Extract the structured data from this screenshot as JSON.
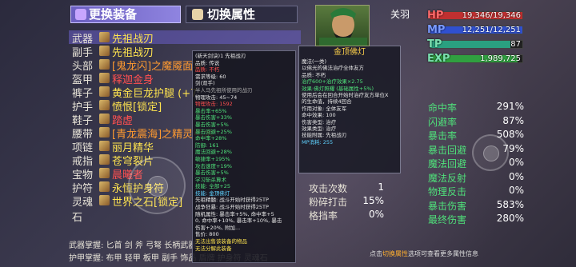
{
  "tabs": {
    "equip": "更换装备",
    "attr": "切换属性"
  },
  "hero": {
    "name": "关羽"
  },
  "bars": [
    {
      "label": "HP",
      "value": "19,346/19,346",
      "color": "#c03030",
      "fill": 1.0
    },
    {
      "label": "MP",
      "value": "12,251/12,251",
      "color": "#3050d0",
      "fill": 1.0
    },
    {
      "label": "TP",
      "value": "87",
      "color": "#2aa080",
      "fill": 0.87
    },
    {
      "label": "EXP",
      "value": "1,989,725",
      "color": "#30a040",
      "fill": 0.95
    }
  ],
  "equipment": [
    {
      "slot": "武器",
      "name": "先祖战刃",
      "color": "#ffe44f"
    },
    {
      "slot": "副手",
      "name": "先祖战刃",
      "color": "#ffe44f"
    },
    {
      "slot": "头部",
      "name": "[鬼龙闪]之魔魇面容",
      "color": "#ff9a30"
    },
    {
      "slot": "盔甲",
      "name": "释迦金身",
      "color": "#ff5050"
    },
    {
      "slot": "裤子",
      "name": "黄金巨龙护腿 (+7",
      "color": "#ffe44f"
    },
    {
      "slot": "护手",
      "name": "愤恨[锁定]",
      "color": "#ffe44f"
    },
    {
      "slot": "鞋子",
      "name": "踏虚",
      "color": "#ff5050"
    },
    {
      "slot": "腰带",
      "name": "[青龙震海]之精灵弓术",
      "color": "#ff9a30"
    },
    {
      "slot": "项链",
      "name": "丽月精华",
      "color": "#ffe44f"
    },
    {
      "slot": "戒指",
      "name": "苍穹裂片",
      "color": "#ffe44f"
    },
    {
      "slot": "宝物",
      "name": "晨曦者",
      "color": "#ff5050"
    },
    {
      "slot": "护符",
      "name": "永恒护身符",
      "color": "#ffe44f"
    },
    {
      "slot": "灵魂石",
      "name": "世界之石[锁定]",
      "color": "#ffe44f"
    }
  ],
  "footer": {
    "weapon_skill": "武器掌握:    匕首 剑 斧 弓弩 长柄武器",
    "armor_skill": "护甲掌握:    布甲 轻甲 板甲 副手 饰品 盾牌 护身符 灵魂石"
  },
  "tooltip1": [
    {
      "t": "(新天剑诀)1   先祖战刃",
      "c": "c-white"
    },
    {
      "t": "品质: 传说",
      "c": "c-white"
    },
    {
      "t": "品质: 不朽",
      "c": "c-red"
    },
    {
      "t": "需求等级: 60",
      "c": "c-white"
    },
    {
      "t": "剑(双手)",
      "c": "c-white"
    },
    {
      "t": "半人马先祖所使用的战刃",
      "c": "c-gray"
    },
    {
      "t": "物理攻击: 45~74",
      "c": "c-white"
    },
    {
      "t": "物理攻击: 1592",
      "c": "c-red"
    },
    {
      "t": "暴击率+65%",
      "c": "c-green"
    },
    {
      "t": "暴击伤害+33%",
      "c": "c-green"
    },
    {
      "t": "暴击伤害+5%",
      "c": "c-green"
    },
    {
      "t": "暴击回避+25%",
      "c": "c-green"
    },
    {
      "t": "命中率+28%",
      "c": "c-green"
    },
    {
      "t": "防御: 161",
      "c": "c-green"
    },
    {
      "t": "魔法回避+28%",
      "c": "c-green"
    },
    {
      "t": "敏捷率+195%",
      "c": "c-green"
    },
    {
      "t": "攻击速度+19%",
      "c": "c-green"
    },
    {
      "t": "暴击伤害+5%",
      "c": "c-green"
    },
    {
      "t": "学习斩杀算术",
      "c": "c-green"
    },
    {
      "t": "技能: 全部+25",
      "c": "c-green"
    },
    {
      "t": "技能: 金顶佛灯",
      "c": "c-cyan"
    },
    {
      "t": "先祖精髓: 战斗开始时获得25TP",
      "c": "c-white"
    },
    {
      "t": "战争狂暴: 战斗开始时获得25TP",
      "c": "c-white"
    },
    {
      "t": "随机属性: 暴击率+5%, 命中率+5",
      "c": "c-white"
    },
    {
      "t": "0, 命中率+10%, 暴击率+10%, 暴击",
      "c": "c-white"
    },
    {
      "t": "伤害+20%, 附加...",
      "c": "c-white"
    },
    {
      "t": "售价: 800",
      "c": "c-white"
    },
    {
      "t": "无法出售该装备的物品",
      "c": "c-yellow"
    },
    {
      "t": "无法分解此装备",
      "c": "c-yellow"
    }
  ],
  "tooltip2": {
    "title": "金顶佛灯",
    "lines": [
      {
        "t": "魔法(一类)",
        "c": "c-white"
      },
      {
        "t": "以佛光的佛法治疗全体友方",
        "c": "c-white"
      },
      {
        "t": "品质: 不朽",
        "c": "c-white"
      },
      {
        "t": "治疗600+治疗效果×2.75",
        "c": "c-green"
      },
      {
        "t": "效果:佛灯照耀 (基础属性+5%)",
        "c": "c-green"
      },
      {
        "t": "使用后会在回合开始时治疗友方单位X",
        "c": "c-white"
      },
      {
        "t": "的生命值，持续4回合",
        "c": "c-white"
      },
      {
        "t": "作用对象: 全体友军",
        "c": "c-white"
      },
      {
        "t": "命中效果: 100",
        "c": "c-white"
      },
      {
        "t": "伤害类型: 治疗",
        "c": "c-white"
      },
      {
        "t": "效果类型: 治疗",
        "c": "c-white"
      },
      {
        "t": "技能附属: 先祖战刃",
        "c": "c-white"
      },
      {
        "t": "MP消耗: 255",
        "c": "c-cyan"
      }
    ]
  },
  "mid_stats": [
    {
      "label": "攻击次数",
      "value": "1"
    },
    {
      "label": "粉碎打击",
      "value": "15%"
    },
    {
      "label": "格挡率",
      "value": "0%"
    }
  ],
  "right_stats": [
    {
      "label": "命中率",
      "value": "291%"
    },
    {
      "label": "闪避率",
      "value": "87%"
    },
    {
      "label": "暴击率",
      "value": "508%"
    },
    {
      "label": "暴击回避",
      "value": "79%"
    },
    {
      "label": "魔法回避",
      "value": "0%"
    },
    {
      "label": "魔法反射",
      "value": "0%"
    },
    {
      "label": "物理反击",
      "value": "0%"
    },
    {
      "label": "暴击伤害",
      "value": "583%"
    },
    {
      "label": "最终伤害",
      "value": "280%"
    }
  ],
  "hint": {
    "pre": "点击",
    "highlight": "切换属性",
    "post": "选项可查看更多属性信息"
  }
}
